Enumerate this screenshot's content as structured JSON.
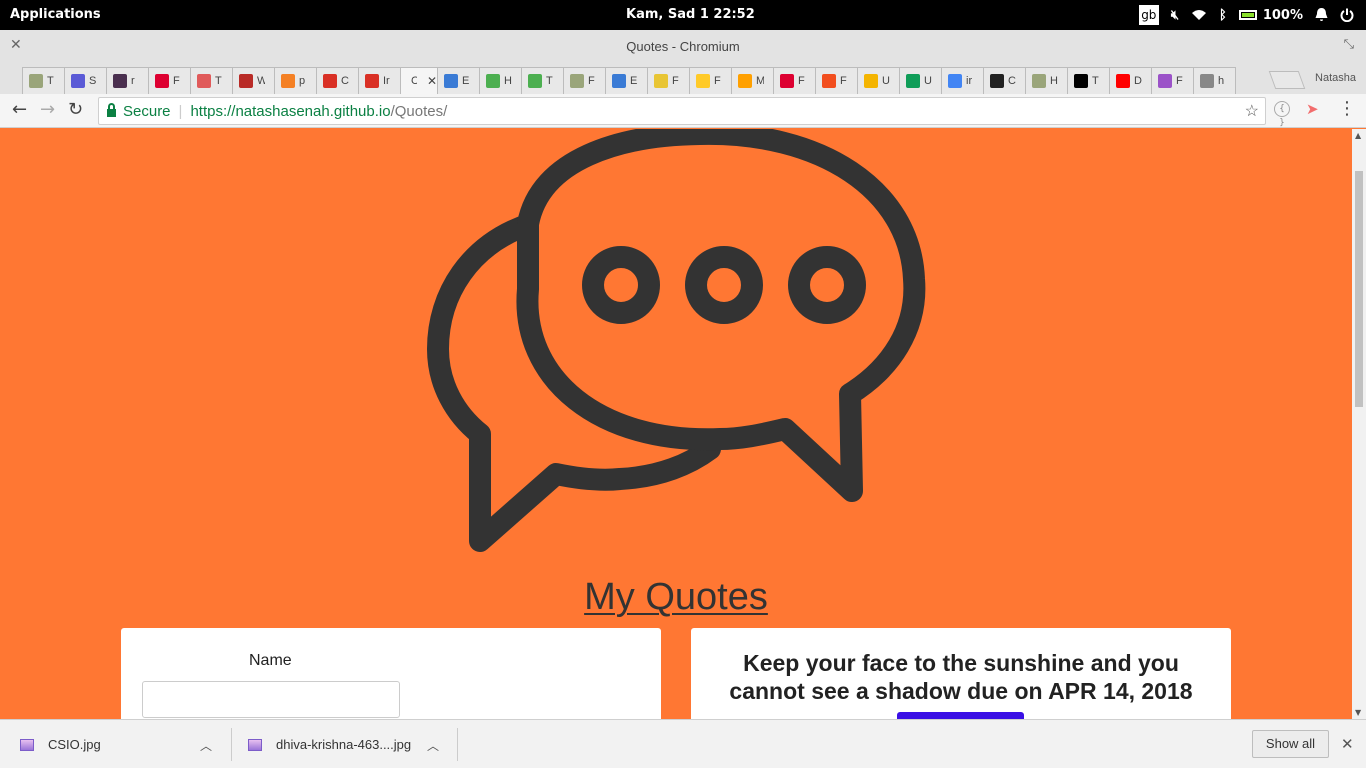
{
  "panel": {
    "apps_label": "Applications",
    "clock": "Kam, Sad  1    22:52",
    "keyboard": "gb",
    "battery": "100%"
  },
  "window": {
    "title": "Quotes - Chromium"
  },
  "tabs": [
    {
      "icon": "tree-icon",
      "label": "T",
      "color": "#9aa57a"
    },
    {
      "icon": "docs-icon",
      "label": "S",
      "color": "#5a5ad6"
    },
    {
      "icon": "slack-icon",
      "label": "r",
      "color": "#4a2f4f"
    },
    {
      "icon": "angular-icon",
      "label": "F",
      "color": "#dd0031"
    },
    {
      "icon": "codepen-icon",
      "label": "T",
      "color": "#e05a5a"
    },
    {
      "icon": "quora-icon",
      "label": "W",
      "color": "#b92b27"
    },
    {
      "icon": "stackoverflow-icon",
      "label": "p",
      "color": "#f48024"
    },
    {
      "icon": "gmail-icon",
      "label": "C",
      "color": "#d93025"
    },
    {
      "icon": "gmail-icon",
      "label": "Ir",
      "color": "#d93025"
    },
    {
      "icon": "blank-icon",
      "label": "C",
      "color": "#ffffff",
      "active": true
    },
    {
      "icon": "bootstrap-icon",
      "label": "E",
      "color": "#3a7bd5"
    },
    {
      "icon": "w3-icon",
      "label": "H",
      "color": "#4caf50"
    },
    {
      "icon": "w3-icon",
      "label": "T",
      "color": "#4caf50"
    },
    {
      "icon": "tree-icon",
      "label": "F",
      "color": "#9aa57a"
    },
    {
      "icon": "bootstrap-icon",
      "label": "E",
      "color": "#3a7bd5"
    },
    {
      "icon": "python-icon",
      "label": "F",
      "color": "#e8c534"
    },
    {
      "icon": "firebase-icon",
      "label": "F",
      "color": "#ffca28"
    },
    {
      "icon": "firebase-icon",
      "label": "M",
      "color": "#ffa000"
    },
    {
      "icon": "angular-icon",
      "label": "F",
      "color": "#dd0031"
    },
    {
      "icon": "figma-icon",
      "label": "F",
      "color": "#f24e1e"
    },
    {
      "icon": "slides-icon",
      "label": "U",
      "color": "#f4b400"
    },
    {
      "icon": "sheets-icon",
      "label": "U",
      "color": "#0f9d58"
    },
    {
      "icon": "google-icon",
      "label": "ir",
      "color": "#4285f4"
    },
    {
      "icon": "camera-icon",
      "label": "C",
      "color": "#222222"
    },
    {
      "icon": "tree-icon",
      "label": "H",
      "color": "#9aa57a"
    },
    {
      "icon": "medium-icon",
      "label": "T",
      "color": "#000000"
    },
    {
      "icon": "youtube-icon",
      "label": "D",
      "color": "#ff0000"
    },
    {
      "icon": "heroku-icon",
      "label": "F",
      "color": "#9b52c8"
    },
    {
      "icon": "file-icon",
      "label": "h",
      "color": "#888888"
    }
  ],
  "profile_name": "Natasha",
  "toolbar": {
    "secure_label": "Secure",
    "url_host": "https://natashasenah.github.io",
    "url_path": "/Quotes/"
  },
  "page": {
    "background": "#ff7733",
    "heading": "My Quotes",
    "form": {
      "name_label": "Name",
      "name_value": ""
    },
    "quote": {
      "text": "Keep your face to the sunshine and you cannot see a shadow due on APR 14, 2018",
      "button_color": "#3a10e5"
    }
  },
  "downloads": {
    "items": [
      {
        "name": "CSIO.jpg"
      },
      {
        "name": "dhiva-krishna-463....jpg"
      }
    ],
    "show_all": "Show all"
  }
}
